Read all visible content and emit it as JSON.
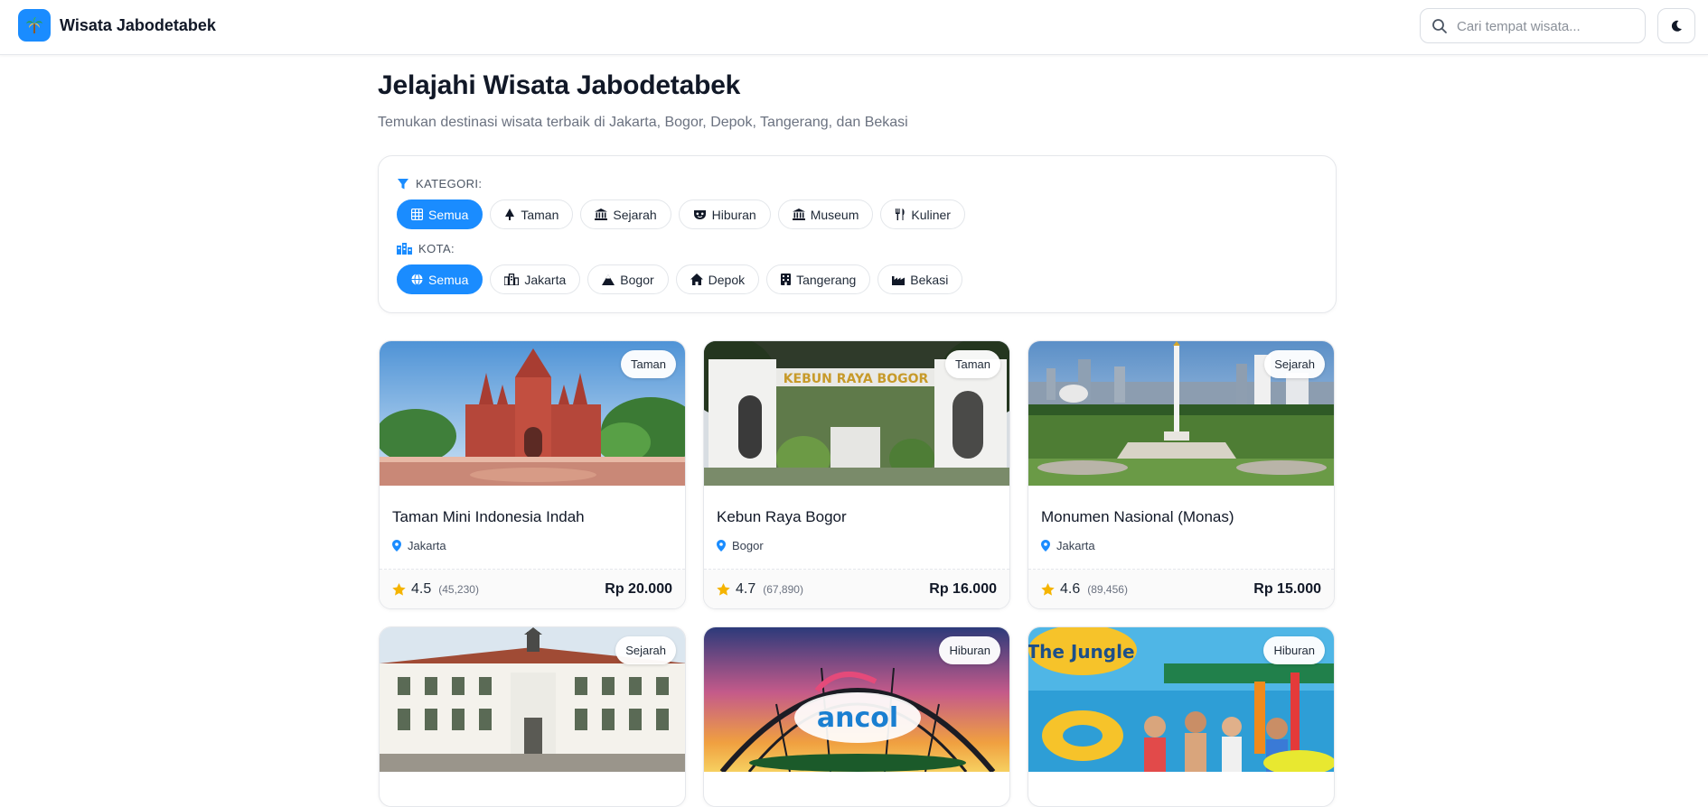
{
  "header": {
    "brand": "Wisata Jabodetabek",
    "search_placeholder": "Cari tempat wisata..."
  },
  "hero": {
    "title": "Jelajahi Wisata Jabodetabek",
    "subtitle": "Temukan destinasi wisata terbaik di Jakarta, Bogor, Depok, Tangerang, dan Bekasi"
  },
  "filters": {
    "category_label": "KATEGORI:",
    "categories": [
      {
        "label": "Semua",
        "icon": "grid-icon",
        "active": true
      },
      {
        "label": "Taman",
        "icon": "tree-icon",
        "active": false
      },
      {
        "label": "Sejarah",
        "icon": "landmark-icon",
        "active": false
      },
      {
        "label": "Hiburan",
        "icon": "mask-icon",
        "active": false
      },
      {
        "label": "Museum",
        "icon": "museum-icon",
        "active": false
      },
      {
        "label": "Kuliner",
        "icon": "utensils-icon",
        "active": false
      }
    ],
    "city_label": "KOTA:",
    "cities": [
      {
        "label": "Semua",
        "icon": "globe-icon",
        "active": true
      },
      {
        "label": "Jakarta",
        "icon": "city-icon",
        "active": false
      },
      {
        "label": "Bogor",
        "icon": "mountain-icon",
        "active": false
      },
      {
        "label": "Depok",
        "icon": "home-icon",
        "active": false
      },
      {
        "label": "Tangerang",
        "icon": "building-icon",
        "active": false
      },
      {
        "label": "Bekasi",
        "icon": "industry-icon",
        "active": false
      }
    ]
  },
  "colors": {
    "accent": "#1a8cff",
    "star": "#f5b400"
  },
  "destinations": [
    {
      "name": "Taman Mini Indonesia Indah",
      "city": "Jakarta",
      "category": "Taman",
      "rating": "4.5",
      "reviews": "(45,230)",
      "price": "Rp 20.000"
    },
    {
      "name": "Kebun Raya Bogor",
      "city": "Bogor",
      "category": "Taman",
      "rating": "4.7",
      "reviews": "(67,890)",
      "price": "Rp 16.000"
    },
    {
      "name": "Monumen Nasional (Monas)",
      "city": "Jakarta",
      "category": "Sejarah",
      "rating": "4.6",
      "reviews": "(89,456)",
      "price": "Rp 15.000"
    },
    {
      "category": "Sejarah"
    },
    {
      "category": "Hiburan"
    },
    {
      "category": "Hiburan"
    }
  ]
}
